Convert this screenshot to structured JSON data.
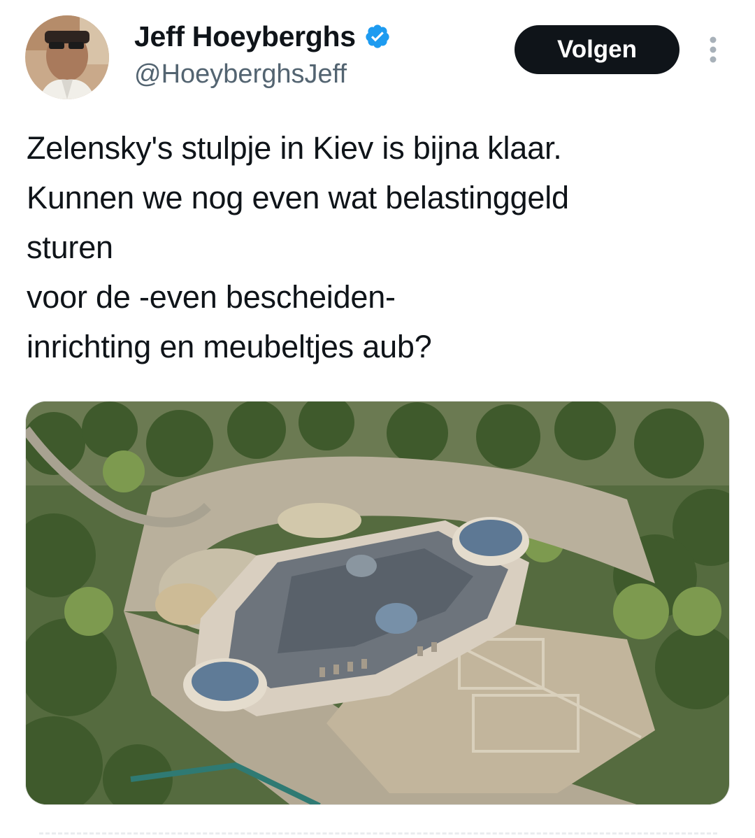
{
  "author": {
    "display_name": "Jeff Hoeyberghs",
    "handle": "@HoeyberghsJeff",
    "verified_icon": "verified-badge-icon",
    "verified_color": "#1d9bf0"
  },
  "actions": {
    "follow_label": "Volgen",
    "more_icon": "more-vertical-icon"
  },
  "tweet": {
    "text_lines": [
      "Zelensky's stulpje in Kiev is bijna klaar.",
      "Kunnen we nog even wat belastinggeld",
      "sturen",
      "voor de -even bescheiden-",
      "inrichting en meubeltjes aub?"
    ]
  },
  "media": {
    "icon": "aerial-photo-palace-image"
  },
  "colors": {
    "text": "#0f1419",
    "secondary_text": "#536471",
    "button_bg": "#0f1419",
    "button_text": "#ffffff"
  }
}
